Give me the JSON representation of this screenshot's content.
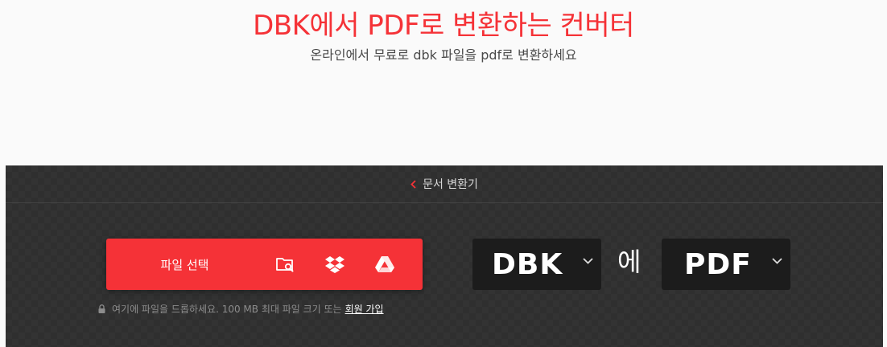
{
  "hero": {
    "title": "DBK에서 PDF로 변환하는 컨버터",
    "subtitle": "온라인에서 무료로 dbk 파일을 pdf로 변환하세요"
  },
  "breadcrumb": {
    "label": "문서 변환기"
  },
  "upload": {
    "button_label": "파일 선택",
    "icons": [
      "folder-search-icon",
      "dropbox-icon",
      "google-drive-icon"
    ]
  },
  "note": {
    "text": "여기에 파일을 드롭하세요. 100 MB 최대 파일 크기 또는",
    "signup_link": "회원 가입"
  },
  "converter": {
    "from_format": "DBK",
    "to_word": "에",
    "to_format": "PDF"
  },
  "colors": {
    "accent": "#f53237",
    "panel": "#333333",
    "select_bg": "#1c1c1c"
  }
}
